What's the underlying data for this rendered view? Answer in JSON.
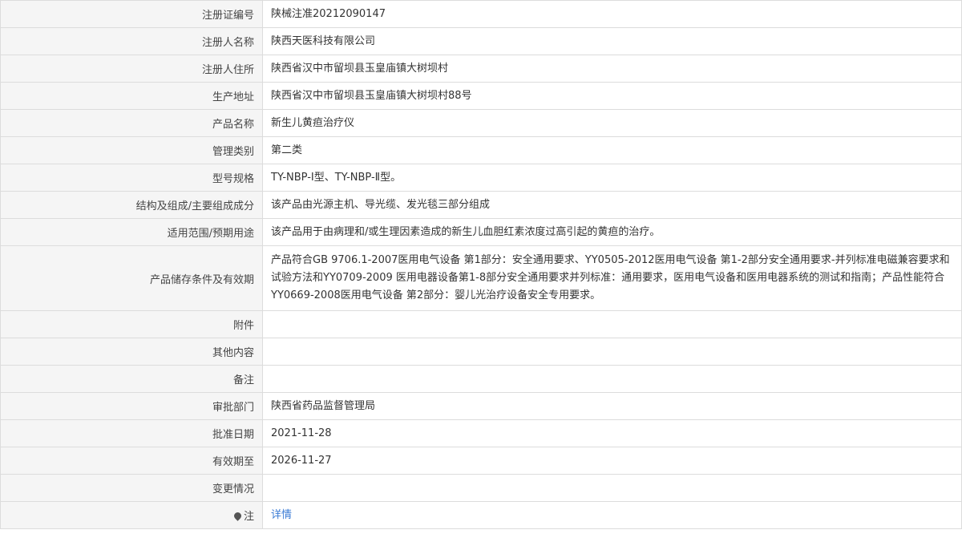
{
  "rows": [
    {
      "label": "注册证编号",
      "value": "陕械注准20212090147"
    },
    {
      "label": "注册人名称",
      "value": "陕西天医科技有限公司"
    },
    {
      "label": "注册人住所",
      "value": "陕西省汉中市留坝县玉皇庙镇大树坝村"
    },
    {
      "label": "生产地址",
      "value": "陕西省汉中市留坝县玉皇庙镇大树坝村88号"
    },
    {
      "label": "产品名称",
      "value": "新生儿黄疸治疗仪"
    },
    {
      "label": "管理类别",
      "value": "第二类"
    },
    {
      "label": "型号规格",
      "value": "TY-NBP-Ⅰ型、TY-NBP-Ⅱ型。"
    },
    {
      "label": "结构及组成/主要组成成分",
      "value": "该产品由光源主机、导光缆、发光毯三部分组成"
    },
    {
      "label": "适用范围/预期用途",
      "value": "该产品用于由病理和/或生理因素造成的新生儿血胆红素浓度过高引起的黄疸的治疗。"
    },
    {
      "label": "产品储存条件及有效期",
      "value": "产品符合GB 9706.1-2007医用电气设备 第1部分：安全通用要求、YY0505-2012医用电气设备 第1-2部分安全通用要求-并列标准电磁兼容要求和试验方法和YY0709-2009 医用电器设备第1-8部分安全通用要求并列标准：通用要求，医用电气设备和医用电器系统的测试和指南；产品性能符合YY0669-2008医用电气设备 第2部分：婴儿光治疗设备安全专用要求。"
    },
    {
      "label": "附件",
      "value": ""
    },
    {
      "label": "其他内容",
      "value": ""
    },
    {
      "label": "备注",
      "value": ""
    },
    {
      "label": "审批部门",
      "value": "陕西省药品监督管理局"
    },
    {
      "label": "批准日期",
      "value": "2021-11-28"
    },
    {
      "label": "有效期至",
      "value": "2026-11-27"
    },
    {
      "label": "变更情况",
      "value": ""
    }
  ],
  "note": {
    "label": "注",
    "link": "详情",
    "icon": "map-pin-icon"
  }
}
